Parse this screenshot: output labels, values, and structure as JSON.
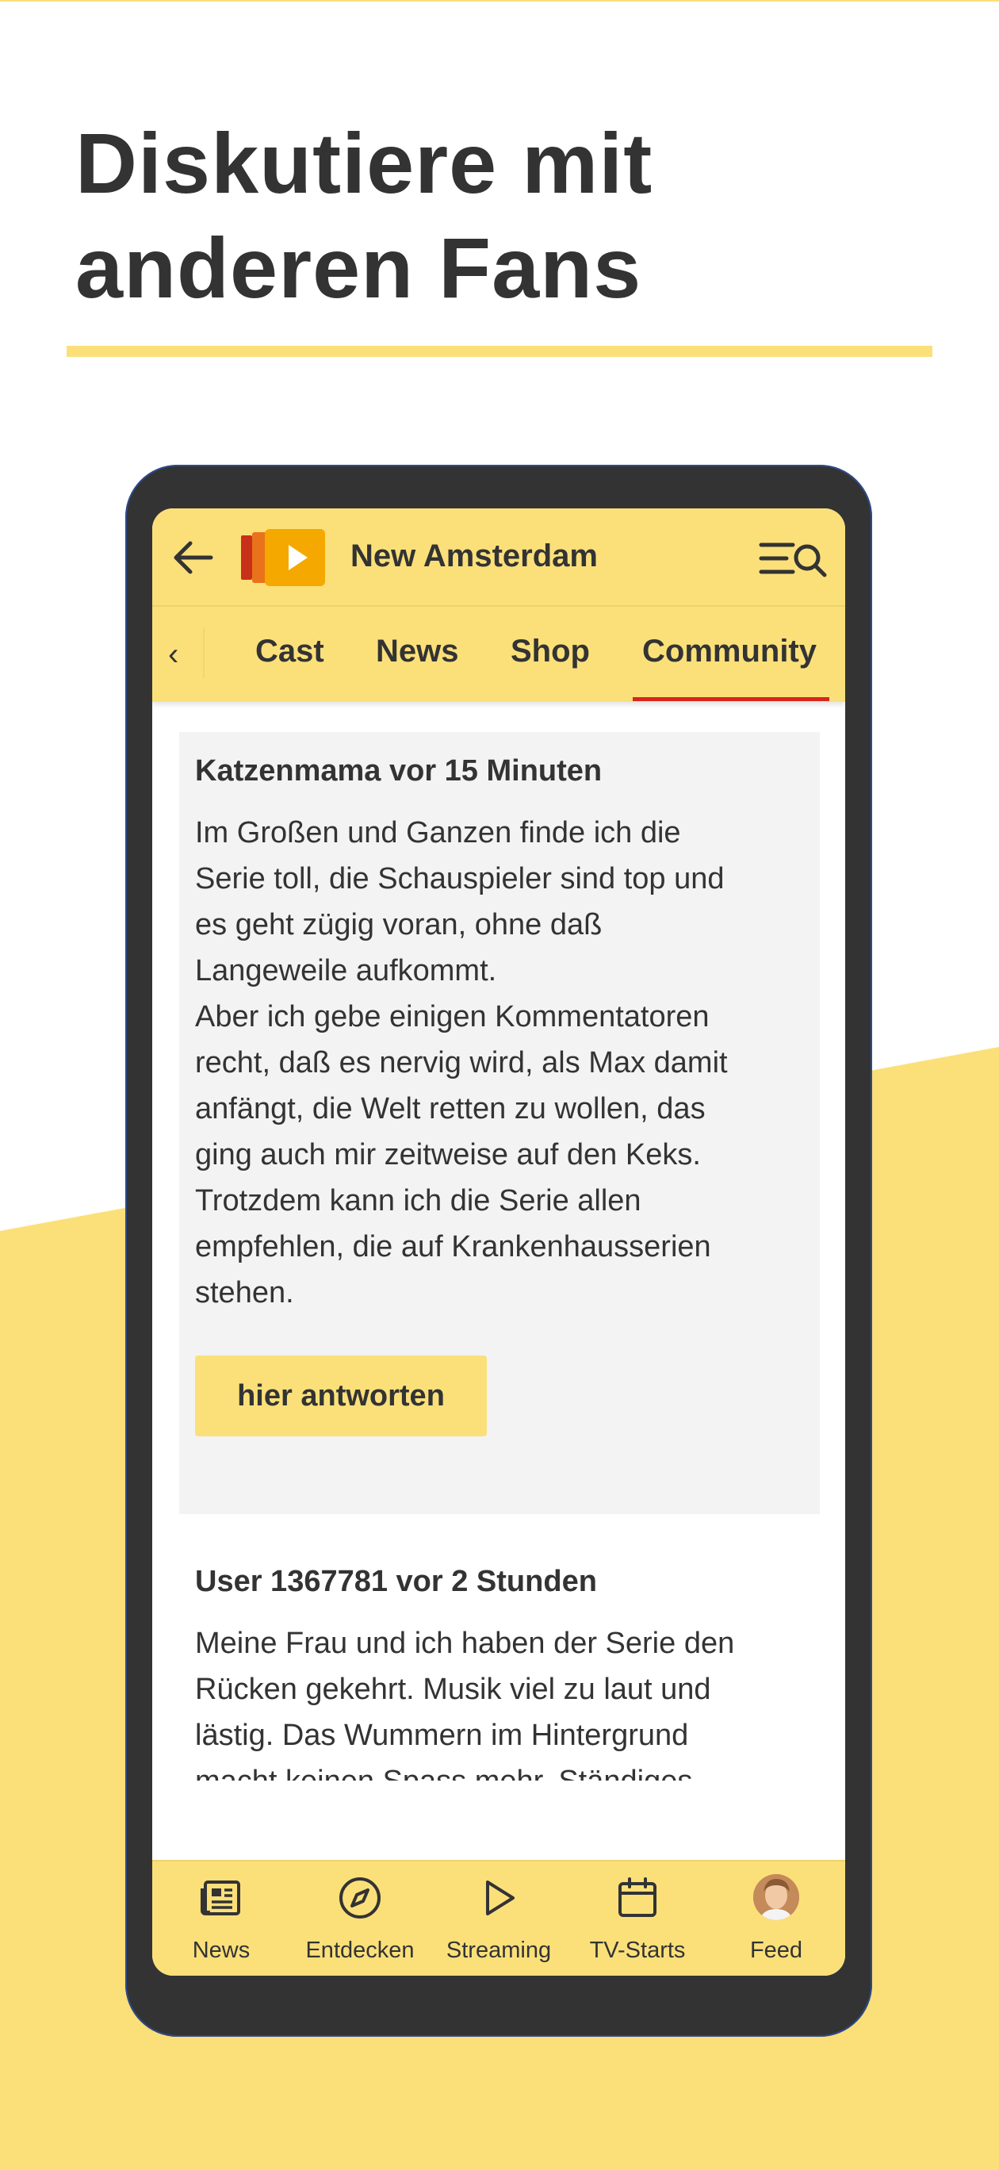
{
  "headline": {
    "line1": "Diskutiere mit",
    "line2": "anderen Fans"
  },
  "colors": {
    "brand_yellow": "#fbe07a",
    "text_dark": "#333333",
    "phone_frame": "#333333",
    "tab_indicator": "#d7261e",
    "comment_bg": "#f3f3f3"
  },
  "app": {
    "title": "New Amsterdam",
    "back_icon": "arrow-left-icon",
    "logo_icon": "play-logo-icon",
    "menu_icon": "menu-search-icon"
  },
  "tabs": {
    "prev_glyph": "‹",
    "items": [
      {
        "label": "Cast"
      },
      {
        "label": "News"
      },
      {
        "label": "Shop"
      },
      {
        "label": "Community",
        "active": true
      }
    ]
  },
  "comments": [
    {
      "author": "Katzenmama vor 15 Minuten",
      "body": "Im Großen und Ganzen finde ich die\nSerie toll, die Schauspieler sind top und\nes geht zügig voran, ohne daß\nLangeweile aufkommt.\nAber ich gebe einigen Kommentatoren\nrecht, daß es nervig wird, als Max damit\nanfängt, die Welt retten zu wollen, das\nging auch mir zeitweise auf den Keks.\nTrotzdem kann ich die Serie allen\nempfehlen, die auf Krankenhausserien\nstehen.",
      "reply_label": "hier antworten"
    },
    {
      "author": "User 1367781 vor 2 Stunden",
      "body": "Meine Frau und ich haben der Serie den\nRücken gekehrt. Musik viel zu laut und\nlästig. Das Wummern im Hintergrund\nmacht keinen Spass mehr. Ständiges\nRegulieren zwischen Sprache und"
    }
  ],
  "bottom_nav": [
    {
      "label": "News",
      "icon": "newspaper-icon"
    },
    {
      "label": "Entdecken",
      "icon": "compass-icon"
    },
    {
      "label": "Streaming",
      "icon": "play-icon"
    },
    {
      "label": "TV-Starts",
      "icon": "calendar-icon"
    },
    {
      "label": "Feed",
      "icon": "avatar"
    }
  ]
}
